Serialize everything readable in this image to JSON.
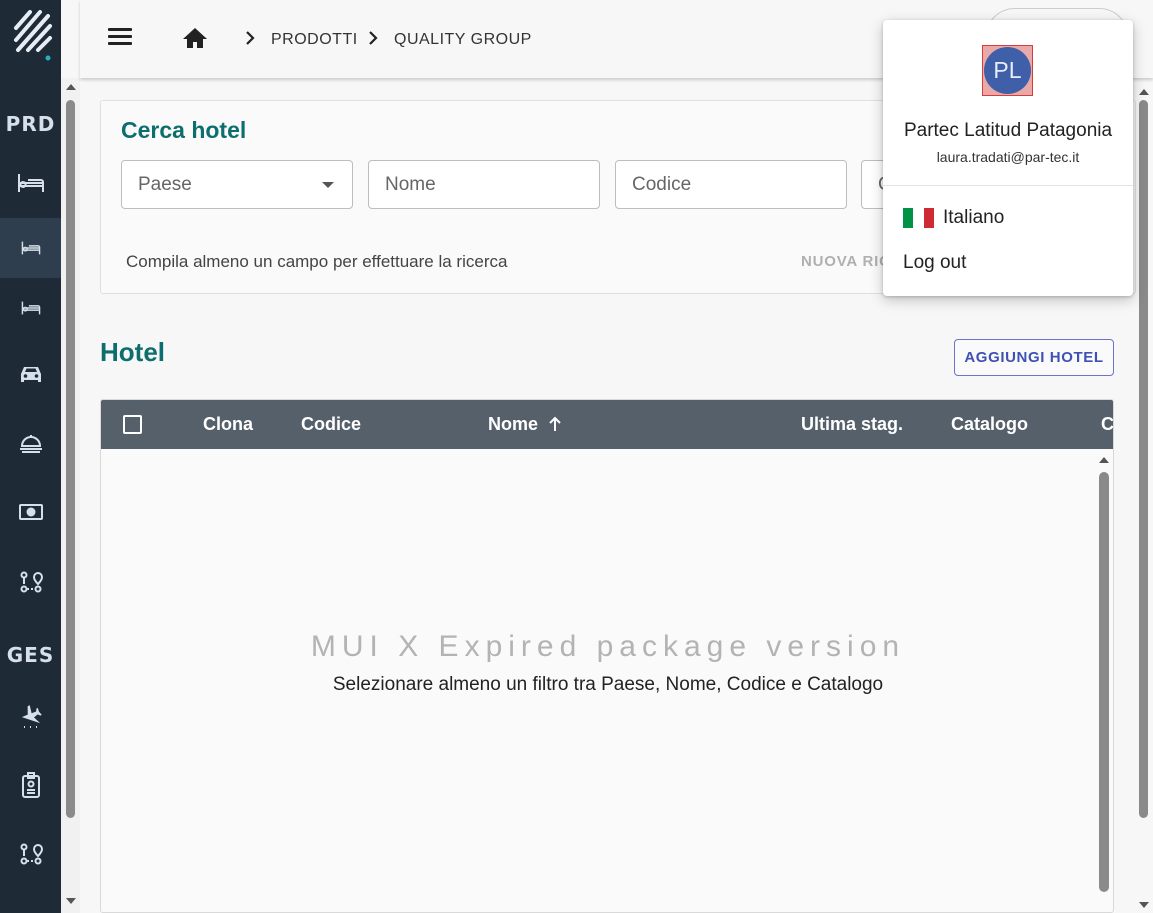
{
  "sidebar": {
    "sections": [
      "PRD",
      "GES"
    ],
    "items": [
      {
        "icon": "bed-icon"
      },
      {
        "icon": "bed-small-icon"
      },
      {
        "icon": "bed-small-icon"
      },
      {
        "icon": "car-icon"
      },
      {
        "icon": "cloche-icon"
      },
      {
        "icon": "money-icon"
      },
      {
        "icon": "route-icon"
      },
      {
        "icon": "airplane-icon"
      },
      {
        "icon": "id-badge-icon"
      },
      {
        "icon": "route-icon"
      }
    ]
  },
  "header": {
    "breadcrumbs": [
      "PRODOTTI",
      "QUALITY GROUP"
    ]
  },
  "search": {
    "title": "Cerca hotel",
    "fields": {
      "country_placeholder": "Paese",
      "name_placeholder": "Nome",
      "code_placeholder": "Codice",
      "catalog_partial": "C"
    },
    "hint": "Compila almeno un campo per effettuare la ricerca",
    "new_search_label": "NUOVA RIC"
  },
  "hotels": {
    "title": "Hotel",
    "add_button": "AGGIUNGI HOTEL",
    "columns": [
      "Clona",
      "Codice",
      "Nome",
      "Ultima stag.",
      "Catalogo",
      "C"
    ],
    "watermark": "MUI X Expired package version",
    "empty_message": "Selezionare almeno un filtro tra Paese, Nome, Codice e Catalogo"
  },
  "user_menu": {
    "initials": "PL",
    "name": "Partec Latitud Patagonia",
    "email": "laura.tradati@par-tec.it",
    "language": "Italiano",
    "logout": "Log out",
    "flag_colors": [
      "#009246",
      "#ffffff",
      "#ce2b37"
    ]
  },
  "colors": {
    "sidebar_bg": "#1e2a36",
    "title_teal": "#0d6e6e",
    "grid_header": "#56606b",
    "accent": "#3f51b5"
  }
}
